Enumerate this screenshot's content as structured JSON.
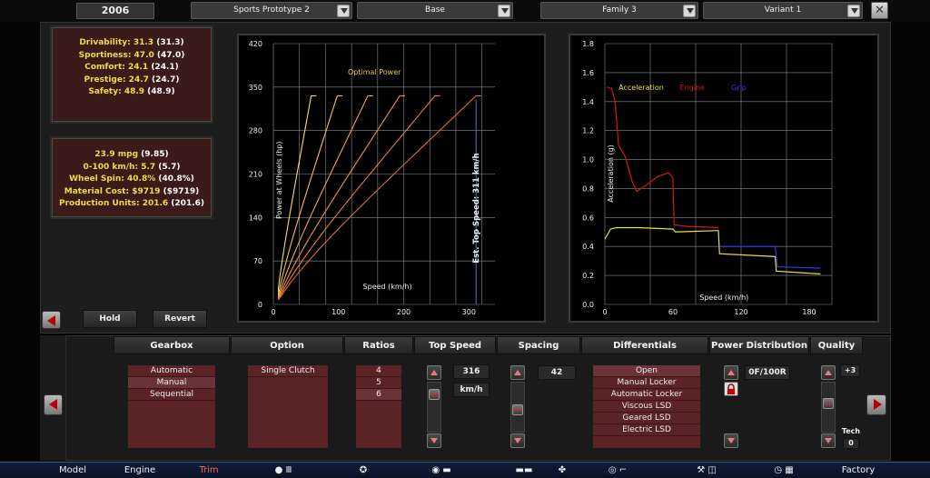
{
  "header": {
    "year": "2006",
    "model_dd": "Sports Prototype 2",
    "trim_dd": "Base",
    "family_dd": "Family 3",
    "variant_dd": "Variant 1"
  },
  "stats1": [
    {
      "label": "Drivability: 31.3",
      "paren": "(31.3)"
    },
    {
      "label": "Sportiness: 47.0",
      "paren": "(47.0)"
    },
    {
      "label": "Comfort: 24.1",
      "paren": "(24.1)"
    },
    {
      "label": "Prestige: 24.7",
      "paren": "(24.7)"
    },
    {
      "label": "Safety: 48.9",
      "paren": "(48.9)"
    }
  ],
  "stats2": [
    {
      "label": "23.9 mpg",
      "paren": "(9.85)"
    },
    {
      "label": "0-100 km/h: 5.7",
      "paren": "(5.7)"
    },
    {
      "label": "Wheel Spin: 40.8%",
      "paren": "(40.8%)"
    },
    {
      "label": "Material Cost: $9719",
      "paren": "($9719)"
    },
    {
      "label": "Production Units: 201.6",
      "paren": "(201.6)"
    }
  ],
  "buttons": {
    "hold": "Hold",
    "revert": "Revert"
  },
  "chart_data": [
    {
      "type": "line",
      "title": "Optimal Power",
      "xlabel": "Speed (km/h)",
      "ylabel": "Power at Wheels (hp)",
      "xlim": [
        0,
        340
      ],
      "ylim": [
        0,
        420
      ],
      "xticks": [
        "0",
        "100",
        "200",
        "300"
      ],
      "yticks": [
        "0",
        "70",
        "140",
        "210",
        "280",
        "350",
        "420"
      ],
      "annotation": "Est. Top Speed: 311 km/h",
      "annotation_x": 311,
      "gears": [
        {
          "top_speed": 58,
          "peak": 336
        },
        {
          "top_speed": 98,
          "peak": 336
        },
        {
          "top_speed": 145,
          "peak": 336
        },
        {
          "top_speed": 194,
          "peak": 336
        },
        {
          "top_speed": 248,
          "peak": 336
        },
        {
          "top_speed": 311,
          "peak": 336
        }
      ]
    },
    {
      "type": "line",
      "xlabel": "Speed (km/h)",
      "ylabel": "Acceleration (g)",
      "xlim": [
        0,
        200
      ],
      "ylim": [
        0,
        1.8
      ],
      "xticks": [
        "0",
        "60",
        "120",
        "180"
      ],
      "yticks": [
        "0.0",
        "0.2",
        "0.4",
        "0.6",
        "0.8",
        "1.0",
        "1.2",
        "1.4",
        "1.6",
        "1.8"
      ],
      "series": [
        {
          "name": "Acceleration",
          "color": "#e8e040",
          "points": [
            [
              0,
              0.45
            ],
            [
              5,
              0.52
            ],
            [
              10,
              0.53
            ],
            [
              30,
              0.53
            ],
            [
              60,
              0.52
            ],
            [
              62,
              0.5
            ],
            [
              100,
              0.51
            ],
            [
              101,
              0.35
            ],
            [
              150,
              0.33
            ],
            [
              151,
              0.23
            ],
            [
              190,
              0.21
            ]
          ]
        },
        {
          "name": "Engine",
          "color": "#d01818",
          "points": [
            [
              2,
              1.5
            ],
            [
              6,
              1.49
            ],
            [
              9,
              1.4
            ],
            [
              12,
              1.1
            ],
            [
              18,
              1.02
            ],
            [
              24,
              0.85
            ],
            [
              28,
              0.78
            ],
            [
              36,
              0.82
            ],
            [
              46,
              0.88
            ],
            [
              56,
              0.91
            ],
            [
              60,
              0.87
            ],
            [
              61,
              0.55
            ],
            [
              70,
              0.54
            ],
            [
              100,
              0.53
            ]
          ]
        },
        {
          "name": "Grip",
          "color": "#3838e0",
          "points": [
            [
              101,
              0.4
            ],
            [
              150,
              0.4
            ],
            [
              152,
              0.26
            ],
            [
              190,
              0.25
            ]
          ]
        }
      ]
    }
  ],
  "bottom": {
    "gearbox": {
      "header": "Gearbox",
      "items": [
        "Automatic",
        "Manual",
        "Sequential"
      ],
      "selected": 1
    },
    "option": {
      "header": "Option",
      "items": [
        "Single Clutch"
      ]
    },
    "ratios": {
      "header": "Ratios",
      "items": [
        "4",
        "5",
        "6"
      ],
      "selected": 2
    },
    "top_speed": {
      "header": "Top Speed",
      "value": "316",
      "unit": "km/h"
    },
    "spacing": {
      "header": "Spacing",
      "value": "42"
    },
    "differentials": {
      "header": "Differentials",
      "items": [
        "Open",
        "Manual Locker",
        "Automatic Locker",
        "Viscous LSD",
        "Geared LSD",
        "Electric LSD"
      ],
      "selected": 0
    },
    "power_distribution": {
      "header": "Power Distribution",
      "value": "0F/100R"
    },
    "quality": {
      "header": "Quality",
      "value": "+3",
      "tech_label": "Tech",
      "tech_value": "0"
    }
  },
  "nav": {
    "model": "Model",
    "engine": "Engine",
    "trim": "Trim",
    "factory": "Factory"
  },
  "colors": {
    "accent_yellow": "#f0dc45",
    "list_red": "#5a2326",
    "nav_active": "#d03030"
  }
}
